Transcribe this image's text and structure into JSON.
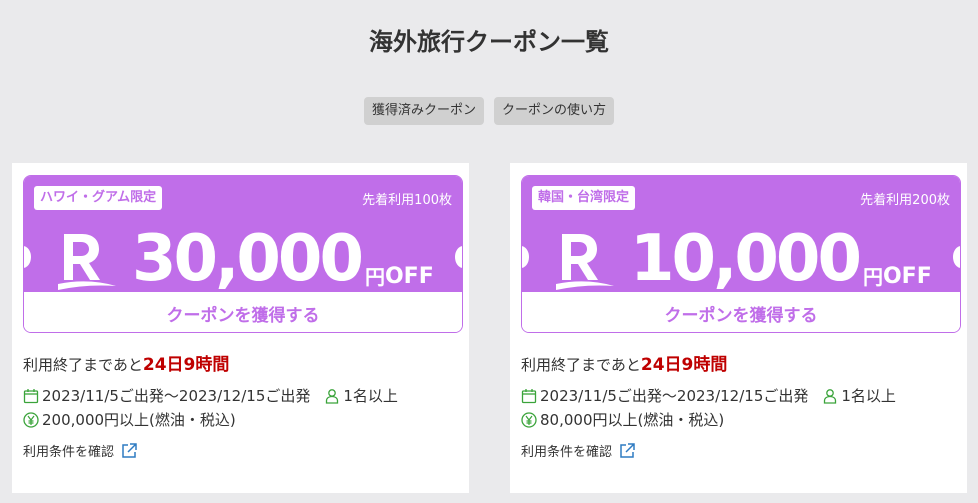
{
  "page": {
    "title": "海外旅行クーポン一覧"
  },
  "nav": {
    "acquired_label": "獲得済みクーポン",
    "howto_label": "クーポンの使い方"
  },
  "coupons": [
    {
      "region": "ハワイ・グアム限定",
      "limit": "先着利用100枚",
      "amount": "30,000",
      "unit": "円",
      "off": "OFF",
      "button": "クーポンを獲得する",
      "remaining_prefix": "利用終了まであと",
      "remaining_value": "24日9時間",
      "period": "2023/11/5ご出発〜2023/12/15ご出発",
      "people": "1名以上",
      "min_price": "200,000円以上(燃油・税込)",
      "terms": "利用条件を確認"
    },
    {
      "region": "韓国・台湾限定",
      "limit": "先着利用200枚",
      "amount": "10,000",
      "unit": "円",
      "off": "OFF",
      "button": "クーポンを獲得する",
      "remaining_prefix": "利用終了まであと",
      "remaining_value": "24日9時間",
      "period": "2023/11/5ご出発〜2023/12/15ご出発",
      "people": "1名以上",
      "min_price": "80,000円以上(燃油・税込)",
      "terms": "利用条件を確認"
    }
  ],
  "colors": {
    "coupon": "#c06ee9",
    "highlight": "#bf0000",
    "icon_green": "#3aa33a",
    "link_blue": "#2f7bc2"
  },
  "icons": {
    "logo": "rakuten-r-logo",
    "calendar": "calendar-icon",
    "person": "person-icon",
    "yen": "yen-icon",
    "external": "external-link-icon"
  }
}
